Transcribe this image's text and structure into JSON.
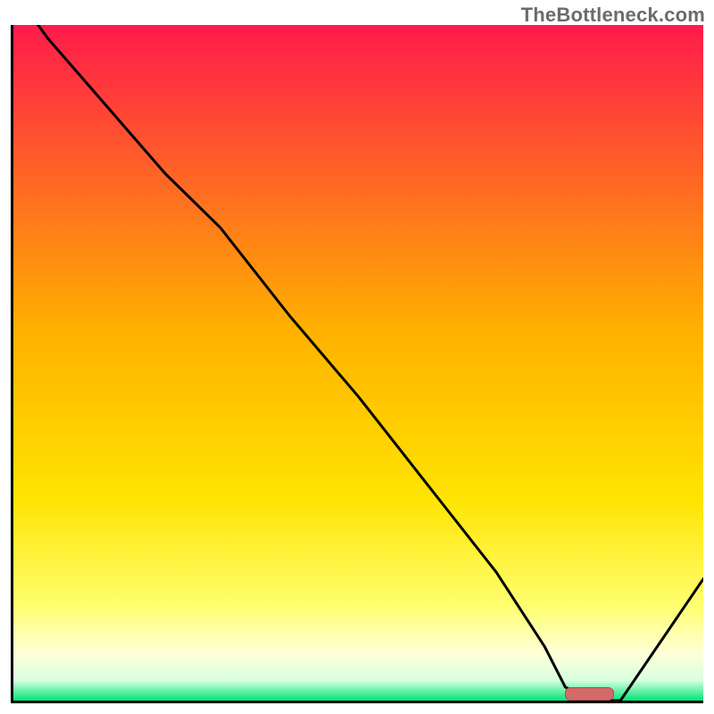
{
  "watermark": {
    "text": "TheBottleneck.com"
  },
  "colors": {
    "gradient_top": "#ff1a4b",
    "gradient_mid": "#ffd12a",
    "gradient_yellow": "#ffff60",
    "gradient_pale": "#ffffe0",
    "gradient_bottom": "#00e676",
    "line": "#000000",
    "marker_fill": "#d46a6a",
    "marker_stroke": "#b04a4a"
  },
  "chart_data": {
    "type": "line",
    "title": "",
    "xlabel": "",
    "ylabel": "",
    "xlim": [
      0,
      100
    ],
    "ylim": [
      0,
      100
    ],
    "x": [
      0,
      5,
      22,
      30,
      40,
      50,
      60,
      70,
      77,
      80,
      84,
      88,
      100
    ],
    "values": [
      105,
      98,
      78,
      70,
      57,
      45,
      32,
      19,
      8,
      2,
      0,
      0,
      18
    ],
    "marker": {
      "x_start": 80,
      "x_end": 87,
      "y": 0
    }
  }
}
